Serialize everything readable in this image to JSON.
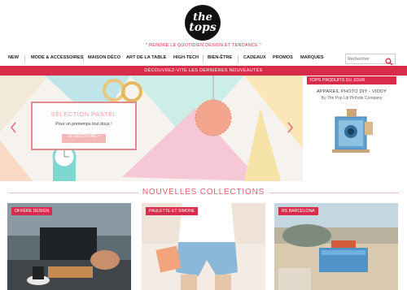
{
  "header": {
    "logo_line1": "the",
    "logo_line2": "tops",
    "tagline": "\" RENDRE LE QUOTIDIEN DESIGN ET TENDANCE \""
  },
  "nav": {
    "items": [
      "NEW",
      "MODE & ACCESSOIRES",
      "MAISON DÉCO",
      "ART DE LA TABLE",
      "HIGH-TECH",
      "BIEN-ÊTRE",
      "CADEAUX",
      "PROMOS",
      "MARQUES"
    ],
    "search_placeholder": "Rechercher"
  },
  "banner": {
    "text": "DÉCOUVREZ-VITE LES DERNIÈRES NOUVEAUTÉS"
  },
  "hero": {
    "title": "SÉLECTION PASTEL",
    "subtitle": "Pour un printemps tout doux !",
    "button": "JE DÉCOUVRE >"
  },
  "product_of_day": {
    "heading": "TOPS PRODUITS DU JOUR",
    "title": "APPAREIL PHOTO DIY - VIDDY",
    "by": "By The Pop Up Pinhole Company"
  },
  "collections": {
    "title": "NOUVELLES COLLECTIONS",
    "cards": [
      {
        "tag": "OFFÉRE DESIGN"
      },
      {
        "tag": "PAULETTE ET SIMONE"
      },
      {
        "tag": "RS BARCELONA"
      }
    ]
  },
  "colors": {
    "accent": "#d92c4a",
    "pink_light": "#f3b9b9",
    "dark": "#111111"
  }
}
